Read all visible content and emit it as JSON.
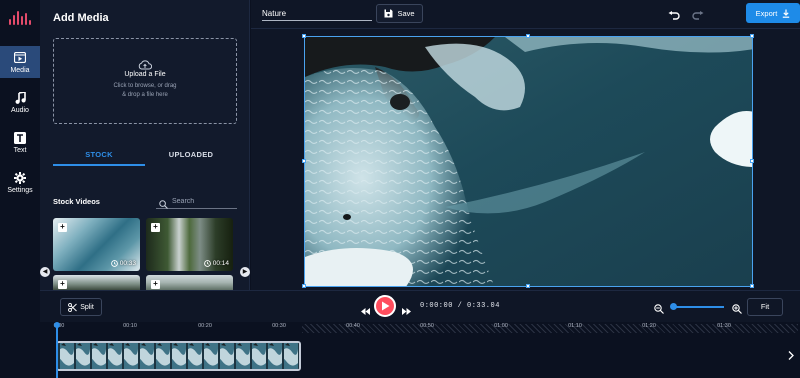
{
  "rail": {
    "items": [
      {
        "label": "Media",
        "icon": "film-icon",
        "active": true
      },
      {
        "label": "Audio",
        "icon": "music-note-icon",
        "active": false
      },
      {
        "label": "Text",
        "icon": "text-icon",
        "active": false
      },
      {
        "label": "Settings",
        "icon": "gear-icon",
        "active": false
      }
    ]
  },
  "media_panel": {
    "title": "Add Media",
    "upload_title": "Upload a File",
    "upload_hint_1": "Click to browse, or drag",
    "upload_hint_2": "& drop a file here",
    "tab_stock": "STOCK",
    "tab_uploaded": "UPLOADED",
    "stock_title": "Stock Videos",
    "search_placeholder": "Search",
    "videos": [
      {
        "duration": "00:33",
        "icon": "ocean-waves-thumbnail"
      },
      {
        "duration": "00:14",
        "icon": "waterfall-thumbnail"
      },
      {
        "duration": "",
        "icon": "mountain-thumbnail"
      },
      {
        "duration": "",
        "icon": "forest-thumbnail"
      }
    ]
  },
  "topbar": {
    "project_name": "Nature",
    "save_label": "Save",
    "export_label": "Export"
  },
  "controls": {
    "split_label": "Split",
    "timecode": "0:00:00 / 0:33.04",
    "fit_label": "Fit",
    "zoom_level": 0.05
  },
  "timeline": {
    "ticks": [
      "0:00",
      "00:10",
      "00:20",
      "00:30",
      "00:40",
      "00:50",
      "01:00",
      "01:10",
      "01:20",
      "01:30"
    ]
  },
  "colors": {
    "accent": "#2e8ee8",
    "play": "#ff4d5e",
    "logo": "#e34b6b",
    "background": "#0b1120"
  }
}
